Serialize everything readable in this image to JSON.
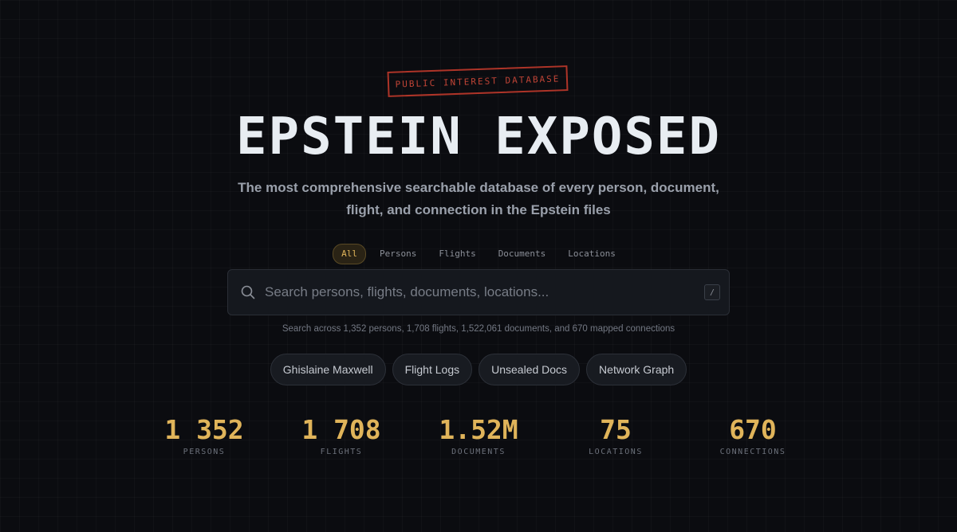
{
  "badge": "PUBLIC INTEREST DATABASE",
  "title": "EPSTEIN EXPOSED",
  "subtitle": "The most comprehensive searchable database of every person, document, flight, and connection in the Epstein files",
  "tabs": [
    {
      "label": "All",
      "active": true
    },
    {
      "label": "Persons",
      "active": false
    },
    {
      "label": "Flights",
      "active": false
    },
    {
      "label": "Documents",
      "active": false
    },
    {
      "label": "Locations",
      "active": false
    }
  ],
  "search": {
    "placeholder": "Search persons, flights, documents, locations...",
    "value": "",
    "shortcut": "/",
    "icon": "search-icon"
  },
  "hint": "Search across 1,352 persons, 1,708 flights, 1,522,061 documents, and 670 mapped connections",
  "quick_links": [
    {
      "label": "Ghislaine Maxwell"
    },
    {
      "label": "Flight Logs"
    },
    {
      "label": "Unsealed Docs"
    },
    {
      "label": "Network Graph"
    }
  ],
  "stats": [
    {
      "value": "1 352",
      "label": "PERSONS"
    },
    {
      "value": "1 708",
      "label": "FLIGHTS"
    },
    {
      "value": "1.52M",
      "label": "DOCUMENTS"
    },
    {
      "value": "75",
      "label": "LOCATIONS"
    },
    {
      "value": "670",
      "label": "CONNECTIONS"
    }
  ],
  "colors": {
    "background": "#0b0c10",
    "accent": "#e0b45a",
    "stamp": "#c0392b"
  }
}
